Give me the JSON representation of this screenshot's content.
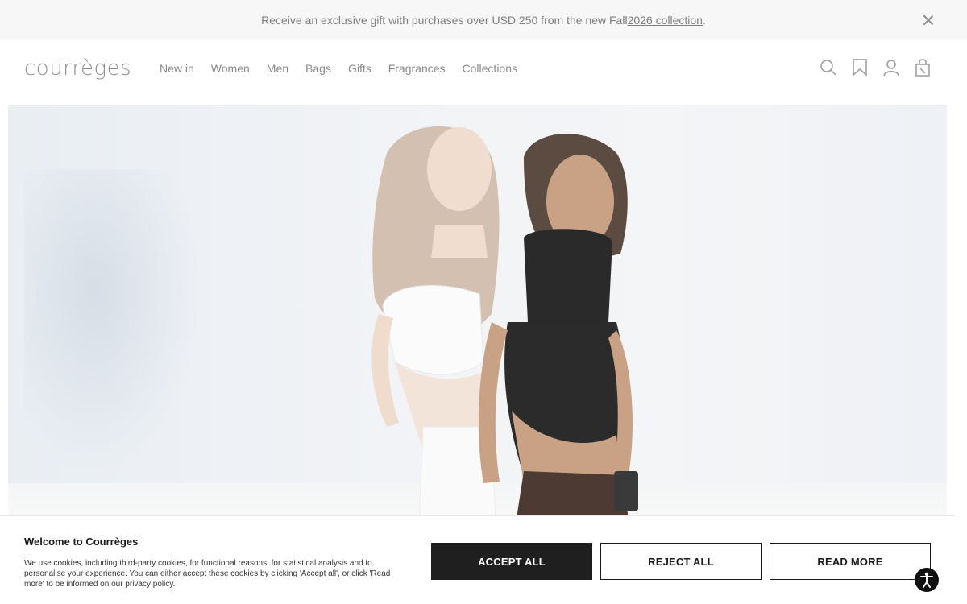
{
  "promo": {
    "text": "Receive an exclusive gift with purchases over USD 250 from the new Fall ",
    "link": "2026 collection",
    "suffix": "."
  },
  "header": {
    "logo": "courrèges",
    "nav": [
      "New in",
      "Women",
      "Men",
      "Bags",
      "Gifts",
      "Fragrances",
      "Collections"
    ],
    "icons": [
      "search-icon",
      "bookmark-icon",
      "account-icon",
      "bag-icon"
    ]
  },
  "cookie": {
    "title": "Welcome to Courrèges",
    "body": "We use cookies, including third-party cookies, for functional reasons, for statistical analysis and to personalise your experience. You can either accept these cookies by clicking 'Accept all', or click 'Read more' to be informed on our privacy policy.",
    "accept": "ACCEPT ALL",
    "reject": "REJECT ALL",
    "more": "READ MORE"
  },
  "colors": {
    "accent": "#1f1f1f",
    "muted": "#8a8a8a"
  }
}
